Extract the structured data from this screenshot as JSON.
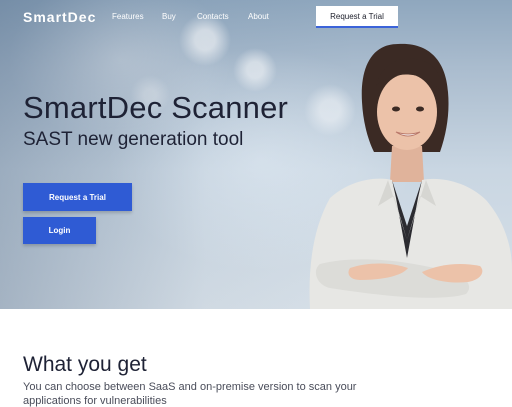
{
  "nav": {
    "logo": "SmartDec",
    "links": [
      "Features",
      "Buy",
      "Contacts",
      "About"
    ],
    "cta_label": "Request a Trial"
  },
  "hero": {
    "title": "SmartDec Scanner",
    "subtitle": "SAST new generation tool",
    "primary_button": "Request a Trial",
    "secondary_button": "Login"
  },
  "section": {
    "title": "What you get",
    "text_line1": "You can choose between SaaS and on-premise version to scan your",
    "text_line2": "applications for vulnerabilities"
  },
  "colors": {
    "accent": "#2f5bd4",
    "heading": "#1e2235",
    "body_text": "#4a4d5a"
  }
}
